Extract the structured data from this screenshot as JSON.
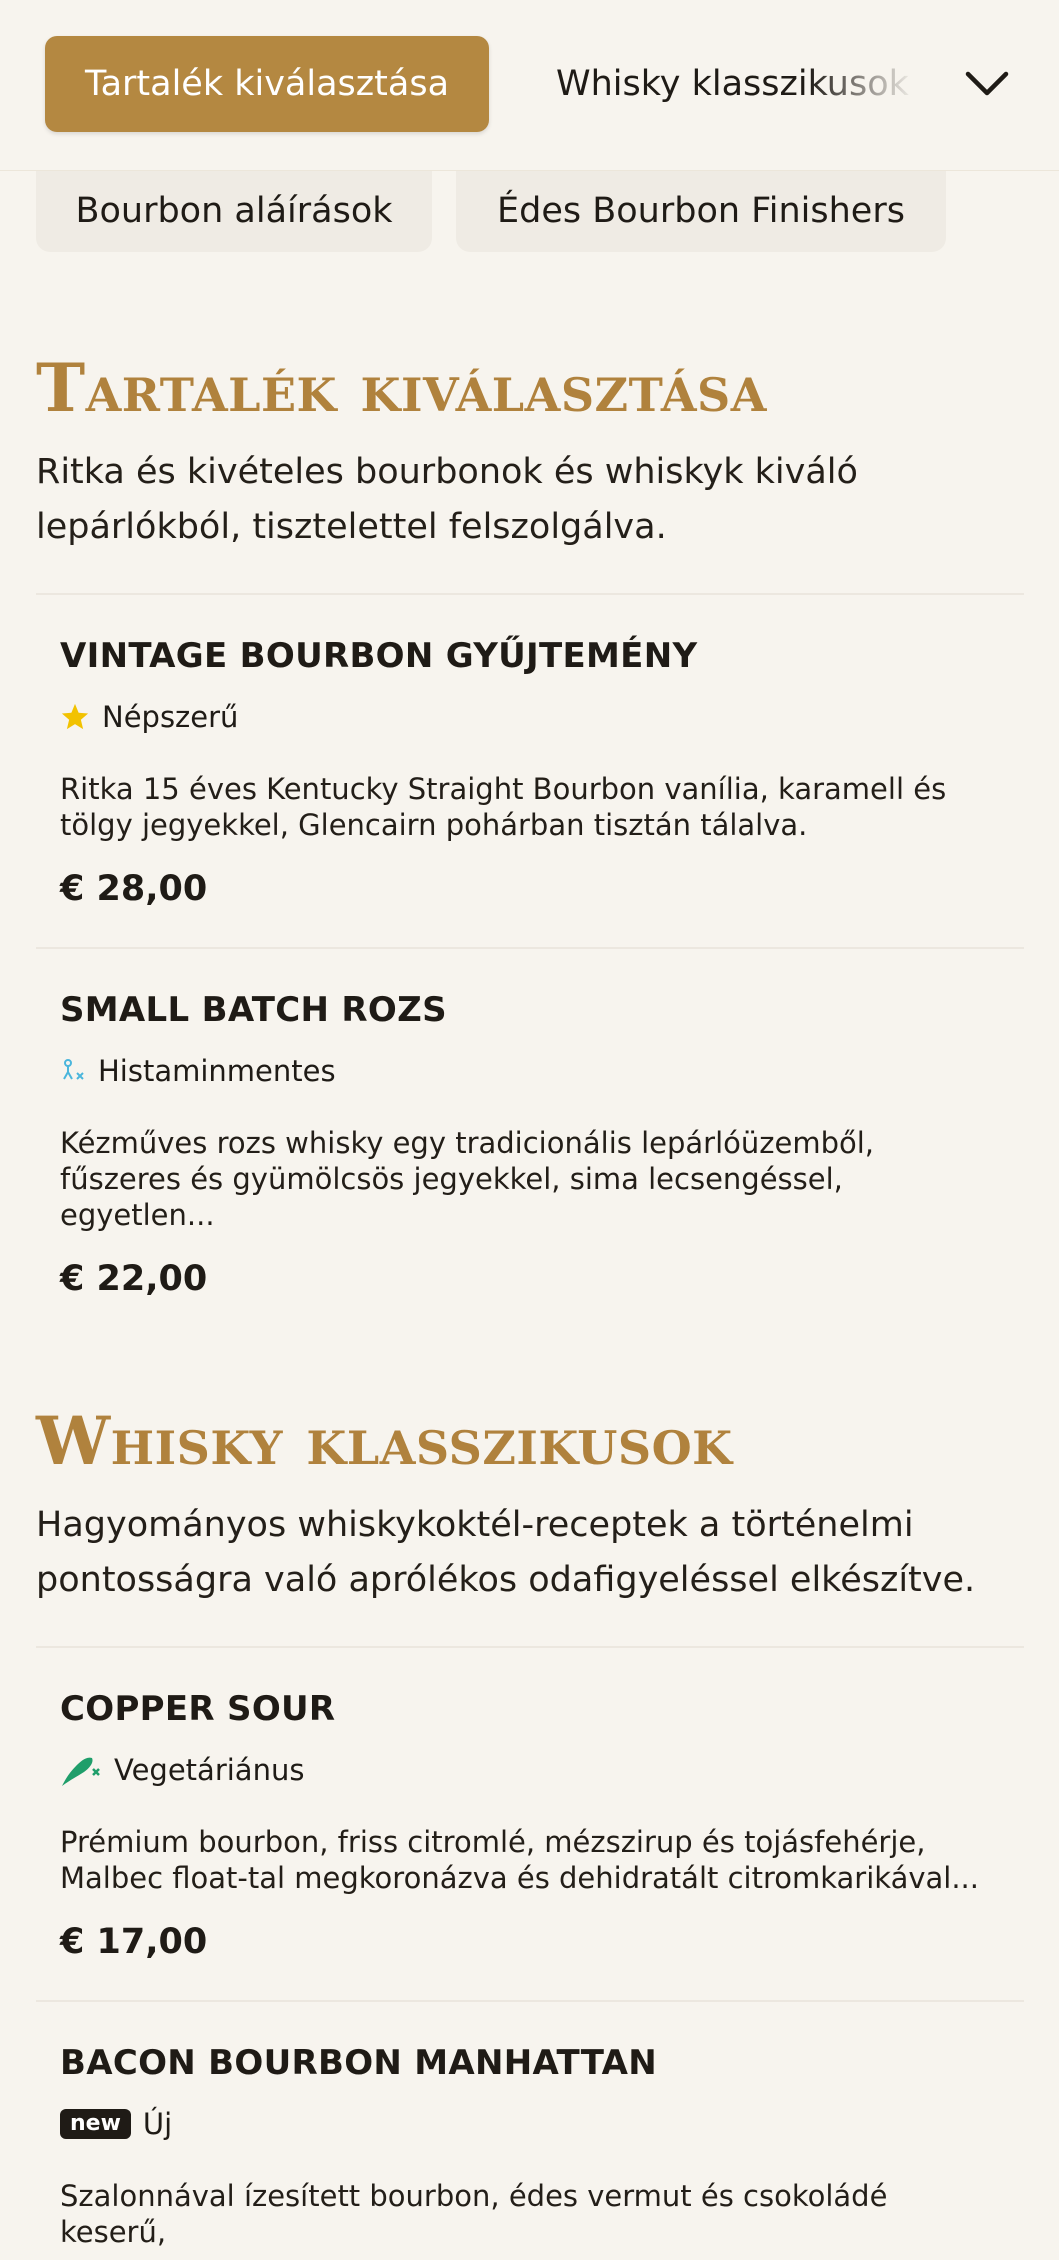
{
  "topbar": {
    "active_tab": "Tartalék kiválasztása",
    "next_tab": "Whisky klasszikusok"
  },
  "categories": [
    "Bourbon aláírások",
    "Édes Bourbon Finishers"
  ],
  "sections": [
    {
      "title": "Tartalék kiválasztása",
      "description": "Ritka és kivételes bourbonok és whiskyk kiváló lepárlókból, tisztelettel felszolgálva.",
      "items": [
        {
          "name": "VINTAGE BOURBON GYŰJTEMÉNY",
          "badge": "Népszerű",
          "badge_icon": "star-icon",
          "description": "Ritka 15 éves Kentucky Straight Bourbon vanília, karamell és tölgy jegyekkel, Glencairn pohárban tisztán tálalva.",
          "price": "€ 28,00"
        },
        {
          "name": "SMALL BATCH ROZS",
          "badge": "Histaminmentes",
          "badge_icon": "histamine-free-icon",
          "description": "Kézműves rozs whisky egy tradicionális lepárlóüzemből, fűszeres és gyümölcsös jegyekkel, sima lecsengéssel, egyetlen...",
          "price": "€ 22,00"
        }
      ]
    },
    {
      "title": "Whisky klasszikusok",
      "description": "Hagyományos whiskykoktél-receptek a történelmi pontosságra való aprólékos odafigyeléssel elkészítve.",
      "items": [
        {
          "name": "COPPER SOUR",
          "badge": "Vegetáriánus",
          "badge_icon": "vegetarian-icon",
          "description": "Prémium bourbon, friss citromlé, mézszirup és tojásfehérje, Malbec float-tal megkoronázva és dehidratált citromkarikával...",
          "price": "€ 17,00"
        },
        {
          "name": "BACON BOURBON MANHATTAN",
          "badge": "Új",
          "badge_pill": "new",
          "badge_icon": "new-pill-icon",
          "description": "Szalonnával ízesített bourbon, édes vermut és csokoládé keserű,",
          "price": ""
        }
      ]
    }
  ],
  "colors": {
    "accent": "#b48841",
    "background": "#f7f4ee",
    "chip": "#efebe4",
    "star": "#f2c200",
    "histamine": "#4bb6dc",
    "vegetarian": "#1f9e6a"
  }
}
